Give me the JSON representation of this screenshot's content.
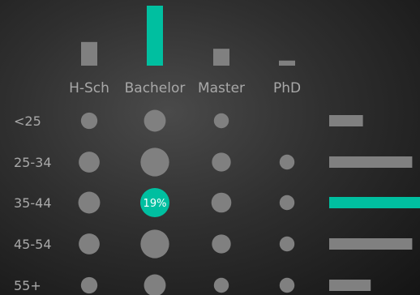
{
  "chart_data": {
    "type": "bubble-matrix",
    "columns": [
      "H-Sch",
      "Bachelor",
      "Master",
      "PhD"
    ],
    "rows": [
      "<25",
      "25-34",
      "35-44",
      "45-54",
      "55+"
    ],
    "cell_values": [
      [
        3,
        8,
        2,
        0
      ],
      [
        7,
        18,
        5,
        2
      ],
      [
        8,
        19,
        6,
        2
      ],
      [
        7,
        18,
        5,
        2
      ],
      [
        3,
        8,
        2,
        2
      ]
    ],
    "highlight": {
      "row": 2,
      "column": 1,
      "label": "19%"
    },
    "column_totals": [
      28,
      71,
      20,
      6
    ],
    "row_totals": [
      13,
      32,
      35,
      32,
      16
    ],
    "colors": {
      "neutral": "#808080",
      "accent": "#00bfa0",
      "text": "#a8a8a8",
      "highlight_text": "#ffffff"
    }
  }
}
